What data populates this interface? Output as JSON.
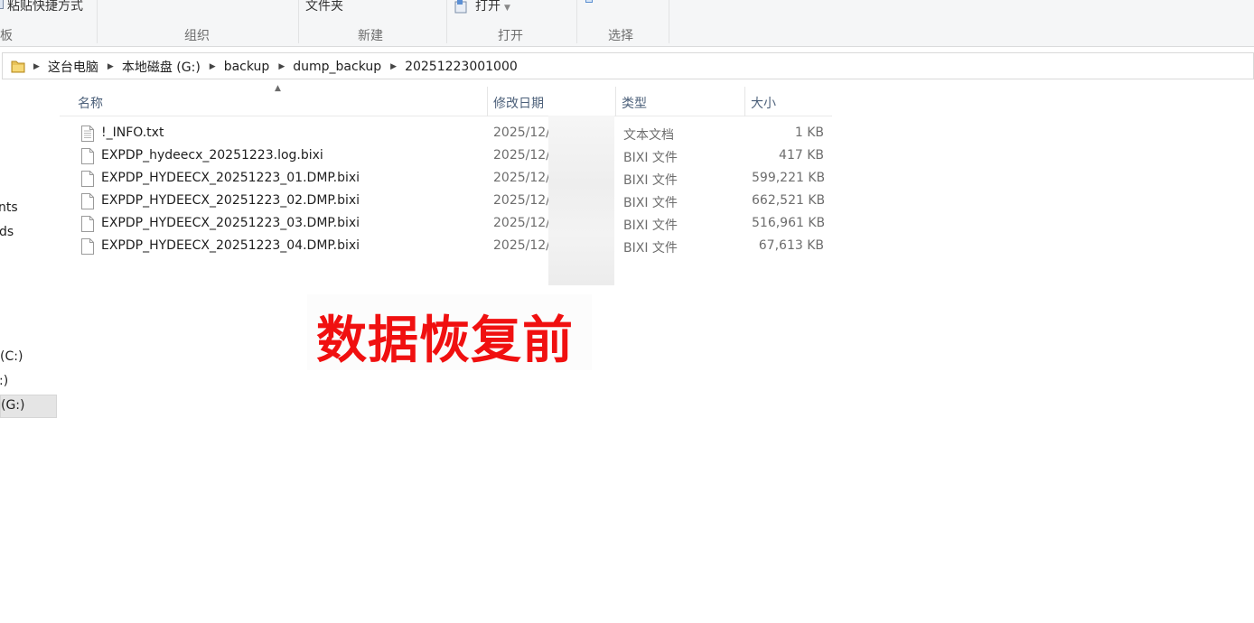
{
  "ribbon": {
    "paste_shortcut_label": "粘贴快捷方式",
    "new_folder_label": "文件夹",
    "open_label": "打开",
    "groups": {
      "clipboard": "板",
      "organize": "组织",
      "new": "新建",
      "open": "打开",
      "select": "选择"
    }
  },
  "address": {
    "crumbs": [
      "这台电脑",
      "本地磁盘 (G:)",
      "backup",
      "dump_backup",
      "20251223001000"
    ]
  },
  "navpane": {
    "items": [
      "nts",
      "ds",
      "(C:)",
      ":)",
      "(G:)"
    ],
    "selected": "(G:)"
  },
  "columns": {
    "name": "名称",
    "date": "修改日期",
    "type": "类型",
    "size": "大小"
  },
  "files": [
    {
      "name": "!_INFO.txt",
      "date": "2025/12/",
      "type": "文本文档",
      "size": "1 KB",
      "icon": "text-file-icon"
    },
    {
      "name": "EXPDP_hydeecx_20251223.log.bixi",
      "date": "2025/12/",
      "type": "BIXI 文件",
      "size": "417 KB",
      "icon": "file-icon"
    },
    {
      "name": "EXPDP_HYDEECX_20251223_01.DMP.bixi",
      "date": "2025/12/",
      "type": "BIXI 文件",
      "size": "599,221 KB",
      "icon": "file-icon"
    },
    {
      "name": "EXPDP_HYDEECX_20251223_02.DMP.bixi",
      "date": "2025/12/",
      "type": "BIXI 文件",
      "size": "662,521 KB",
      "icon": "file-icon"
    },
    {
      "name": "EXPDP_HYDEECX_20251223_03.DMP.bixi",
      "date": "2025/12/",
      "type": "BIXI 文件",
      "size": "516,961 KB",
      "icon": "file-icon"
    },
    {
      "name": "EXPDP_HYDEECX_20251223_04.DMP.bixi",
      "date": "2025/12/",
      "type": "BIXI 文件",
      "size": "67,613 KB",
      "icon": "file-icon"
    }
  ],
  "overlay": {
    "caption": "数据恢复前",
    "color": "#f01010"
  }
}
